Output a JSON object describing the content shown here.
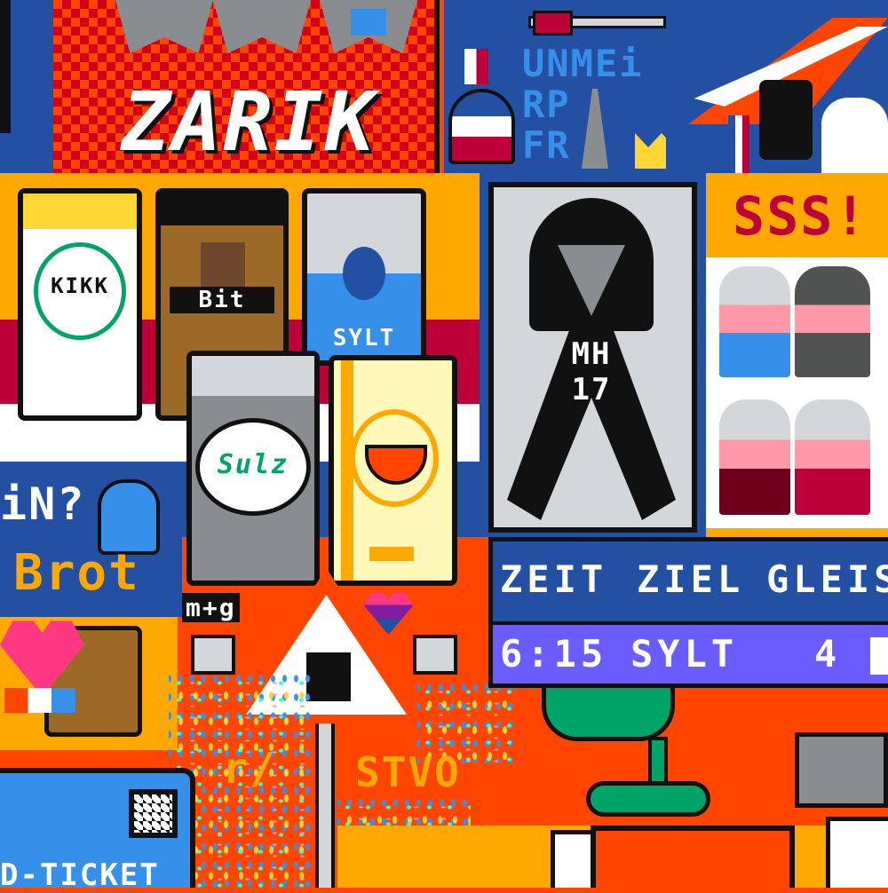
{
  "canvas": {
    "tiles": {
      "zarik": {
        "label": "ZARIK"
      },
      "unmei": {
        "lines": [
          "UNMEi",
          "RP",
          "FR"
        ]
      },
      "cans": {
        "can1": {
          "label": "KIKK"
        },
        "can2": {
          "label": "Bit"
        },
        "can3": {
          "label": "SYLT"
        },
        "can4": {
          "label": "Sulz"
        },
        "mg": {
          "label": "m+g"
        }
      },
      "ribbon": {
        "line1": "MH",
        "line2": "17"
      },
      "sss": {
        "label": "SSS!"
      },
      "brot": {
        "q": "iN?",
        "label": "Brot"
      },
      "departure_board": {
        "headers": {
          "time": "ZEIT",
          "dest": "ZIEL",
          "track": "GLEIS"
        },
        "row": {
          "time": "6:15",
          "dest": "SYLT",
          "track": "4"
        }
      },
      "stvo": {
        "prefix": "r/",
        "label": "STVO"
      },
      "ticket": {
        "label": "D-TICKET"
      }
    },
    "colors": {
      "orange": "#ff4500",
      "red": "#be0039",
      "blue": "#2450a4",
      "lightblue": "#3690ea",
      "yellow": "#ffa800",
      "purple": "#6a5cff",
      "black": "#111111",
      "white": "#ffffff",
      "gray": "#d4d7d9"
    }
  }
}
